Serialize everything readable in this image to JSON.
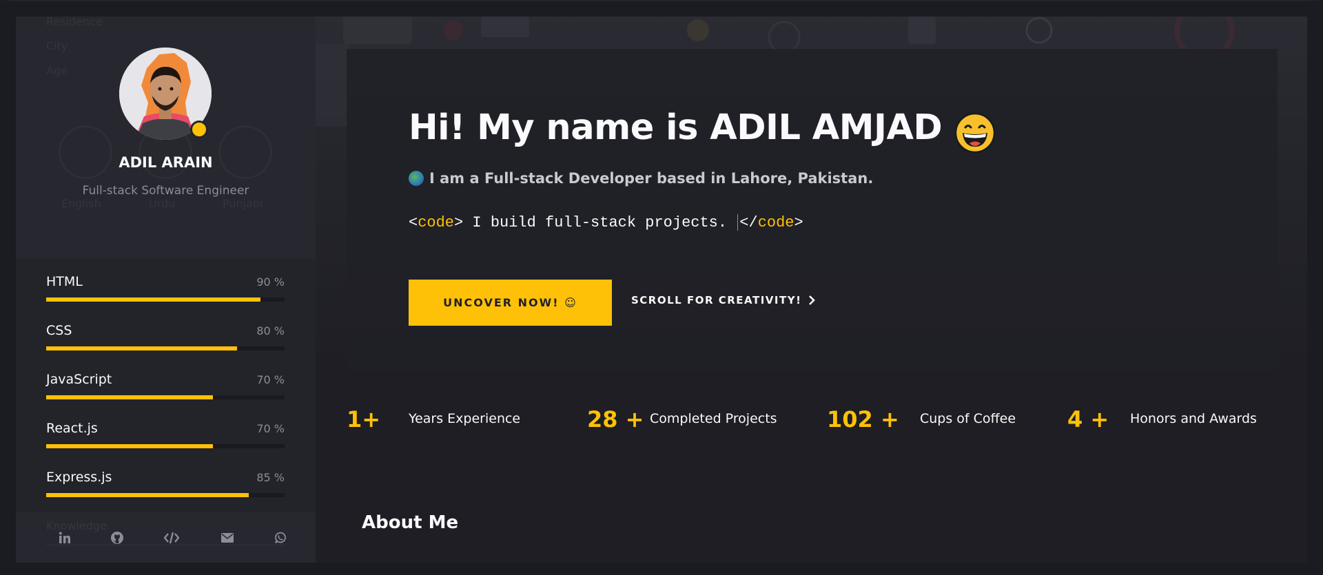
{
  "sidebar": {
    "ghost_labels": [
      "Residence",
      "City",
      "Age"
    ],
    "ghost_languages": [
      "English",
      "Urdu",
      "Punjabi"
    ],
    "profile": {
      "name": "ADIL ARAIN",
      "role": "Full-stack Software Engineer",
      "status_color": "#ffc107"
    },
    "skills": [
      {
        "name": "HTML",
        "percent_label": "90 %",
        "value": 90
      },
      {
        "name": "CSS",
        "percent_label": "80 %",
        "value": 80
      },
      {
        "name": "JavaScript",
        "percent_label": "70 %",
        "value": 70
      },
      {
        "name": "React.js",
        "percent_label": "70 %",
        "value": 70
      },
      {
        "name": "Express.js",
        "percent_label": "85 %",
        "value": 85
      }
    ],
    "ghost_section": "Knowledge",
    "social": [
      {
        "icon": "linkedin-icon"
      },
      {
        "icon": "github-icon"
      },
      {
        "icon": "code-icon"
      },
      {
        "icon": "envelope-icon"
      },
      {
        "icon": "whatsapp-icon"
      }
    ]
  },
  "hero": {
    "title": "Hi! My name is ADIL AMJAD",
    "title_emoji": "grinning-face-icon",
    "subtitle": "I am a Full-stack Developer based in Lahore, Pakistan.",
    "code_open_prefix": "<",
    "code_tag": "code",
    "code_open_suffix": ">",
    "code_text": " I build full-stack projects. ",
    "code_close_prefix": "</",
    "code_close_suffix": ">",
    "primary_button": "UNCOVER NOW! ☺",
    "secondary_link": "SCROLL FOR CREATIVITY!",
    "accent_color": "#ffc107"
  },
  "stats": [
    {
      "number": "1+",
      "label": "Years Experience"
    },
    {
      "number": "28 +",
      "label": "Completed Projects"
    },
    {
      "number": "102 +",
      "label": "Cups of Coffee"
    },
    {
      "number": "4 +",
      "label": "Honors and Awards"
    }
  ],
  "about": {
    "title": "About Me"
  }
}
